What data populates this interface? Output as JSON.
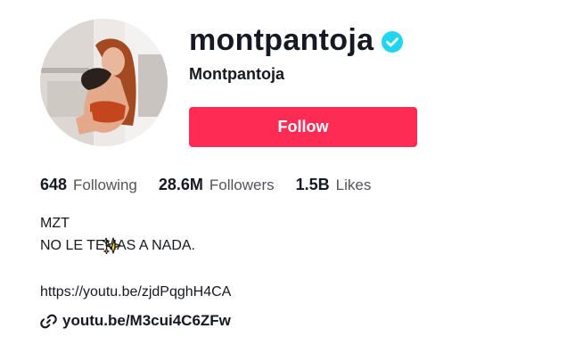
{
  "profile": {
    "username": "montpantoja",
    "nickname": "Montpantoja",
    "verified": true,
    "follow_label": "Follow"
  },
  "stats": {
    "following_value": "648",
    "following_label": "Following",
    "followers_value": "28.6M",
    "followers_label": "Followers",
    "likes_value": "1.5B",
    "likes_label": "Likes"
  },
  "bio": {
    "line1": "MZT",
    "line2": "NO LE TEMAS A NADA.",
    "line3": "https://youtu.be/zjdPqghH4CA"
  },
  "link": {
    "text": "youtu.be/M3cui4C6ZFw",
    "icon": "link-icon"
  },
  "colors": {
    "accent": "#fe2c55",
    "verified": "#20d5ec",
    "text": "#161823"
  }
}
